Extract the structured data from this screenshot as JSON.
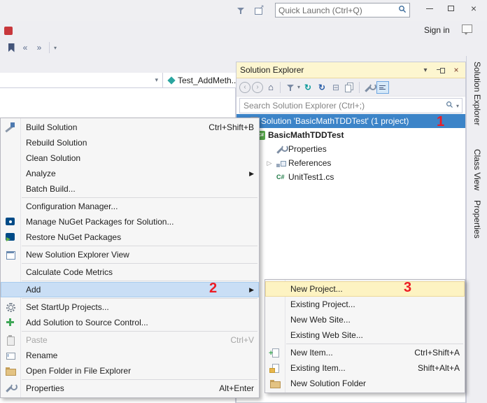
{
  "titlebar": {
    "quick_launch_placeholder": "Quick Launch (Ctrl+Q)",
    "sign_in": "Sign in"
  },
  "editor": {
    "method_dropdown": "Test_AddMeth..."
  },
  "solution_explorer": {
    "title": "Solution Explorer",
    "search_placeholder": "Search Solution Explorer (Ctrl+;)",
    "tree": [
      {
        "label": "Solution 'BasicMathTDDTest' (1 project)"
      },
      {
        "label": "BasicMathTDDTest"
      },
      {
        "label": "Properties"
      },
      {
        "label": "References"
      },
      {
        "label": "UnitTest1.cs"
      }
    ]
  },
  "side_tabs": [
    {
      "label": "Solution Explorer"
    },
    {
      "label": "Class View"
    },
    {
      "label": "Properties"
    }
  ],
  "context_menu": {
    "items": [
      {
        "label": "Build Solution",
        "shortcut": "Ctrl+Shift+B"
      },
      {
        "label": "Rebuild Solution"
      },
      {
        "label": "Clean Solution"
      },
      {
        "label": "Analyze"
      },
      {
        "label": "Batch Build..."
      },
      {
        "label": "Configuration Manager..."
      },
      {
        "label": "Manage NuGet Packages for Solution..."
      },
      {
        "label": "Restore NuGet Packages"
      },
      {
        "label": "New Solution Explorer View"
      },
      {
        "label": "Calculate Code Metrics"
      },
      {
        "label": "Add"
      },
      {
        "label": "Set StartUp Projects..."
      },
      {
        "label": "Add Solution to Source Control..."
      },
      {
        "label": "Paste",
        "shortcut": "Ctrl+V"
      },
      {
        "label": "Rename"
      },
      {
        "label": "Open Folder in File Explorer"
      },
      {
        "label": "Properties",
        "shortcut": "Alt+Enter"
      }
    ]
  },
  "add_submenu": {
    "items": [
      {
        "label": "New Project..."
      },
      {
        "label": "Existing Project..."
      },
      {
        "label": "New Web Site..."
      },
      {
        "label": "Existing Web Site..."
      },
      {
        "label": "New Item...",
        "shortcut": "Ctrl+Shift+A"
      },
      {
        "label": "Existing Item...",
        "shortcut": "Shift+Alt+A"
      },
      {
        "label": "New Solution Folder"
      }
    ]
  },
  "annotations": {
    "n1": "1",
    "n2": "2",
    "n3": "3"
  }
}
